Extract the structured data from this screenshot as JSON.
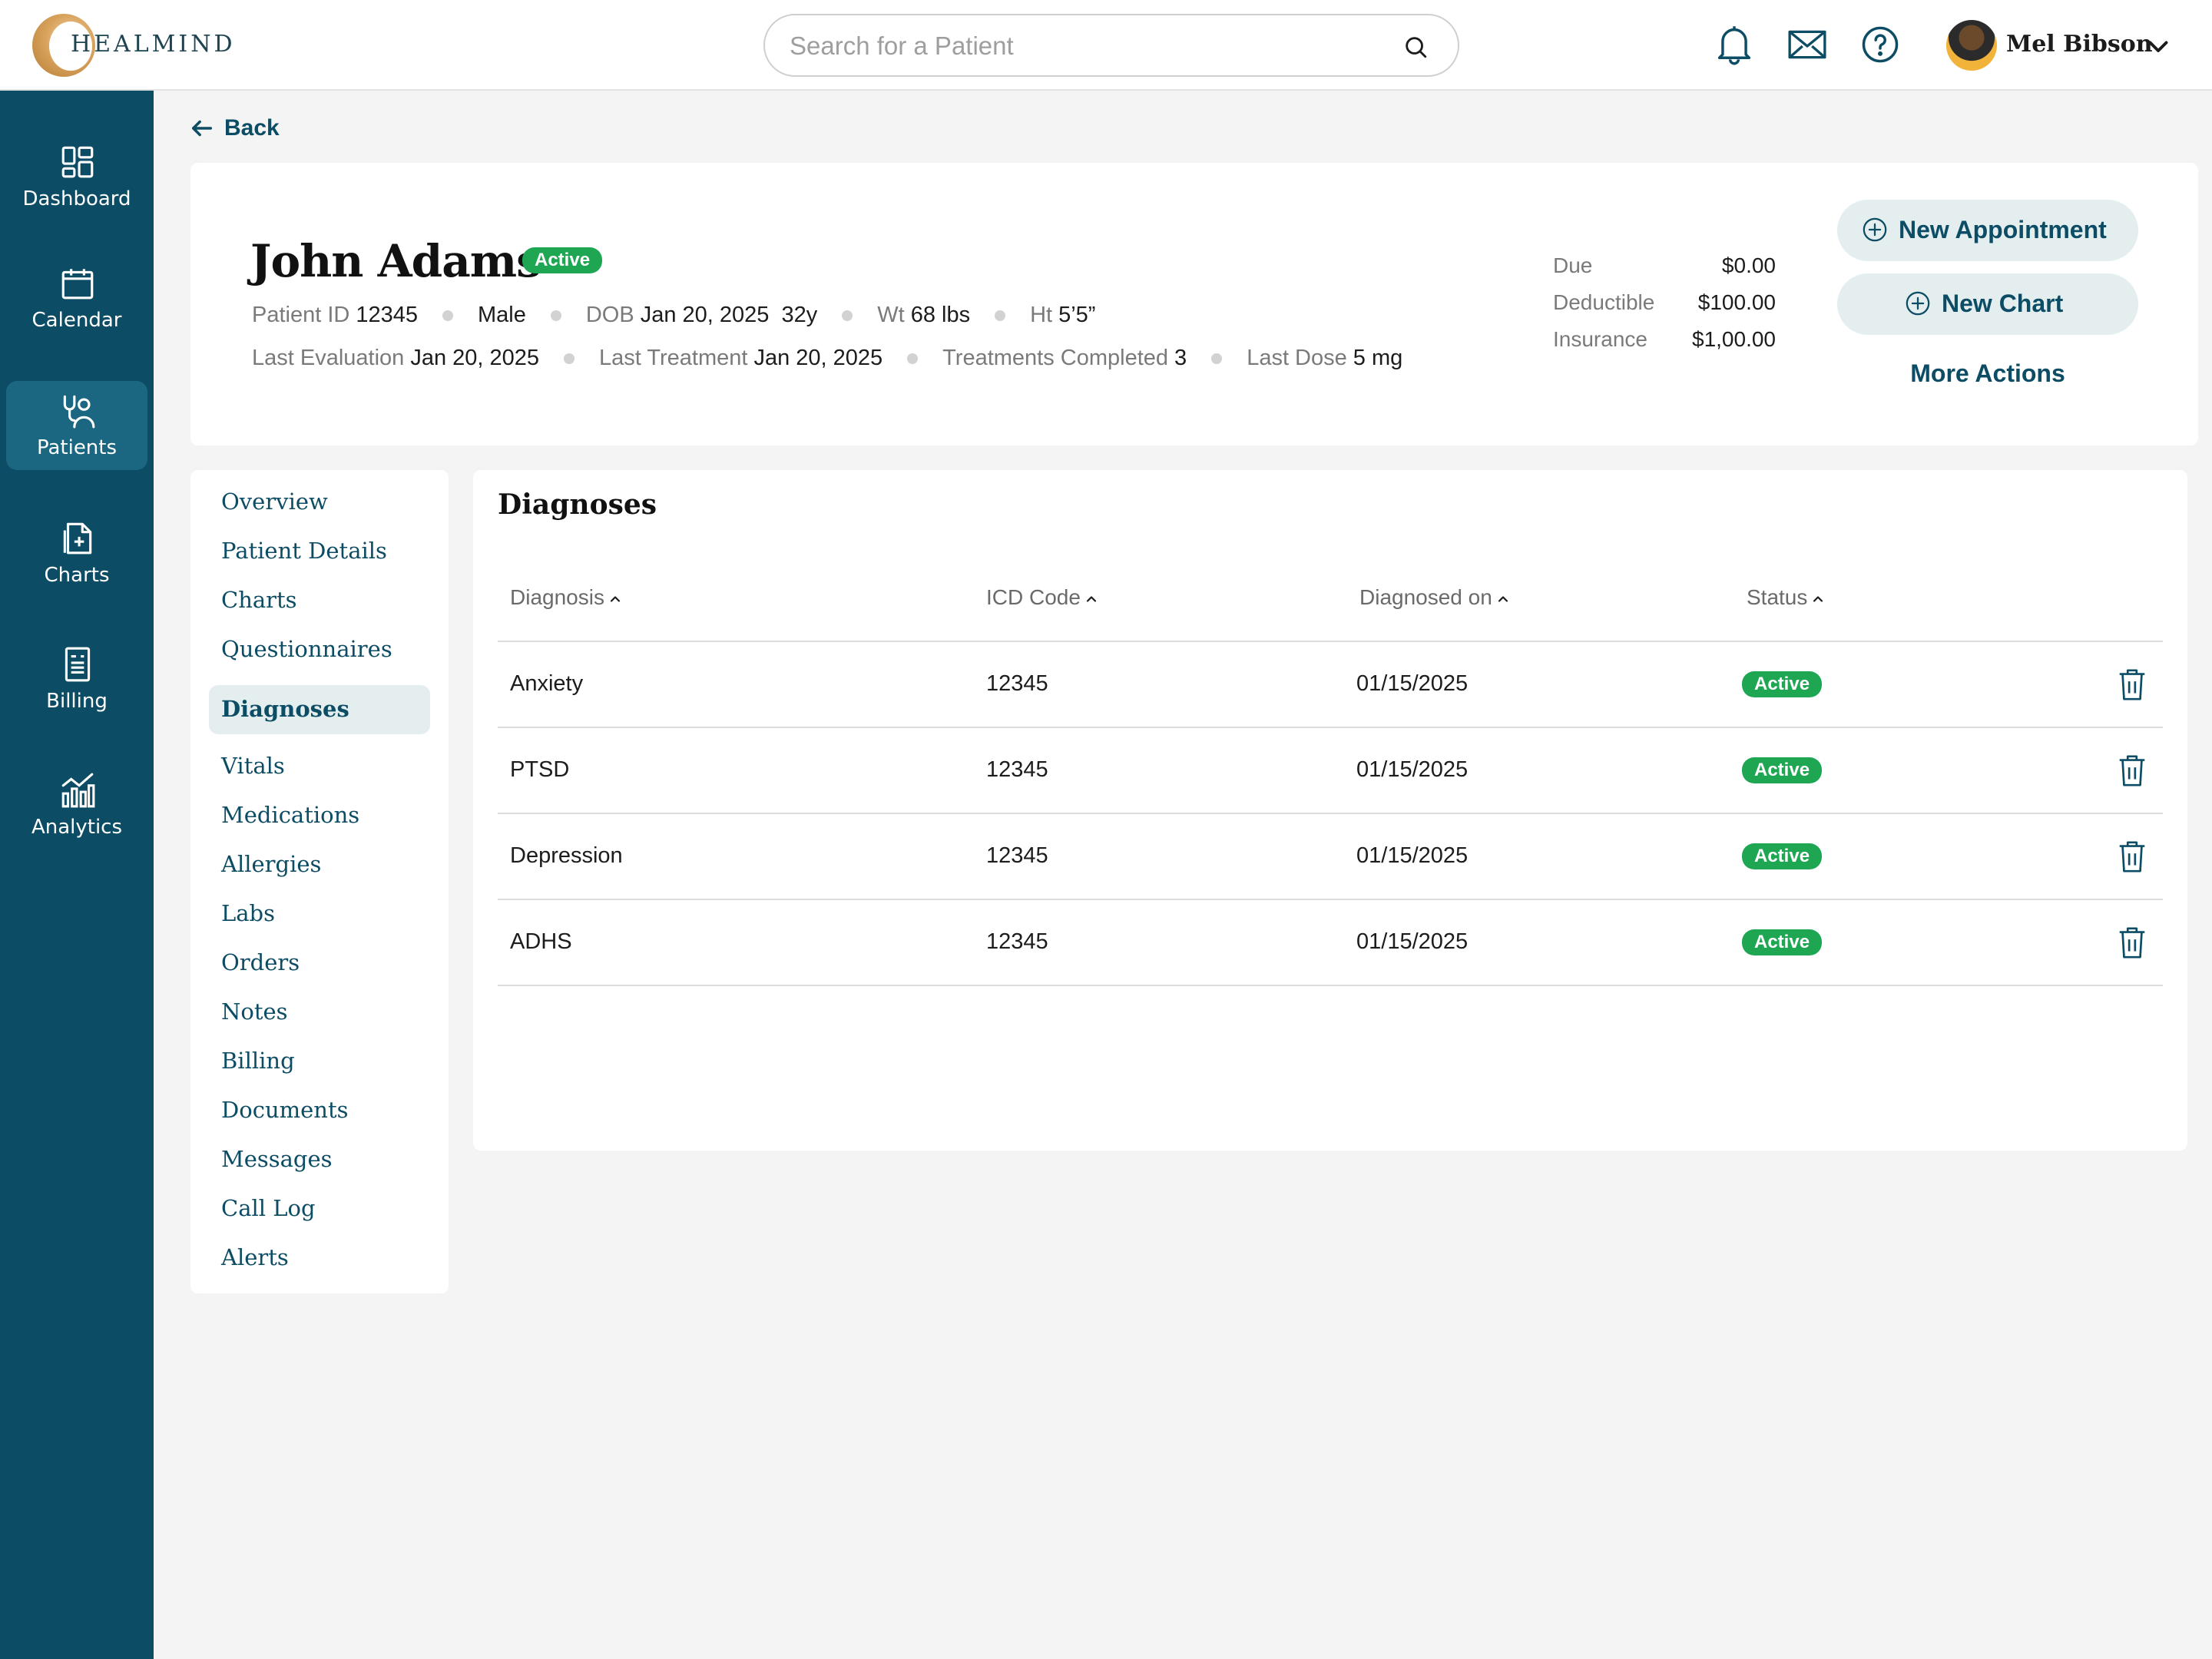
{
  "brand": {
    "name": "HEALMIND"
  },
  "search": {
    "placeholder": "Search for a Patient"
  },
  "header_icons": [
    "bell-icon",
    "mail-icon",
    "help-icon"
  ],
  "user": {
    "name": "Mel Bibson"
  },
  "sidebar": {
    "items": [
      {
        "label": "Dashboard",
        "icon": "dashboard-icon",
        "active": false
      },
      {
        "label": "Calendar",
        "icon": "calendar-icon",
        "active": false
      },
      {
        "label": "Patients",
        "icon": "patients-icon",
        "active": true
      },
      {
        "label": "Charts",
        "icon": "charts-icon",
        "active": false
      },
      {
        "label": "Billing",
        "icon": "billing-icon",
        "active": false
      },
      {
        "label": "Analytics",
        "icon": "analytics-icon",
        "active": false
      }
    ]
  },
  "back": {
    "label": "Back"
  },
  "patient": {
    "name": "John Adams",
    "status": "Active",
    "meta1": [
      {
        "label": "Patient ID",
        "value": "12345"
      },
      {
        "label": "",
        "value": "Male"
      },
      {
        "label": "DOB",
        "value": "Jan 20, 2025  32y"
      },
      {
        "label": "Wt",
        "value": "68 lbs"
      },
      {
        "label": "Ht",
        "value": "5’5”"
      }
    ],
    "meta2": [
      {
        "label": "Last Evaluation",
        "value": "Jan 20, 2025"
      },
      {
        "label": "Last Treatment",
        "value": "Jan 20, 2025"
      },
      {
        "label": "Treatments Completed",
        "value": "3"
      },
      {
        "label": "Last Dose",
        "value": "5 mg"
      }
    ]
  },
  "finance": [
    {
      "label": "Due",
      "value": "$0.00"
    },
    {
      "label": "Deductible",
      "value": "$100.00"
    },
    {
      "label": "Insurance",
      "value": "$1,00.00"
    }
  ],
  "actions": {
    "new_appointment": "New Appointment",
    "new_chart": "New Chart",
    "more_actions": "More Actions"
  },
  "subnav": {
    "items": [
      {
        "label": "Overview"
      },
      {
        "label": "Patient Details"
      },
      {
        "label": "Charts"
      },
      {
        "label": "Questionnaires"
      },
      {
        "label": "Diagnoses",
        "active": true
      },
      {
        "label": "Vitals"
      },
      {
        "label": "Medications"
      },
      {
        "label": "Allergies"
      },
      {
        "label": "Labs"
      },
      {
        "label": "Orders"
      },
      {
        "label": "Notes"
      },
      {
        "label": "Billing"
      },
      {
        "label": "Documents"
      },
      {
        "label": "Messages"
      },
      {
        "label": "Call Log"
      },
      {
        "label": "Alerts"
      }
    ]
  },
  "diagnoses": {
    "title": "Diagnoses",
    "columns": [
      "Diagnosis",
      "ICD Code",
      "Diagnosed on",
      "Status"
    ],
    "rows": [
      {
        "diagnosis": "Anxiety",
        "icd": "12345",
        "date": "01/15/2025",
        "status": "Active"
      },
      {
        "diagnosis": "PTSD",
        "icd": "12345",
        "date": "01/15/2025",
        "status": "Active"
      },
      {
        "diagnosis": "Depression",
        "icd": "12345",
        "date": "01/15/2025",
        "status": "Active"
      },
      {
        "diagnosis": "ADHS",
        "icd": "12345",
        "date": "01/15/2025",
        "status": "Active"
      }
    ]
  },
  "colors": {
    "primary": "#0c4c64",
    "accent_bg": "#e4eeef",
    "status_active": "#1fa653",
    "page_bg": "#f4f4f4"
  }
}
